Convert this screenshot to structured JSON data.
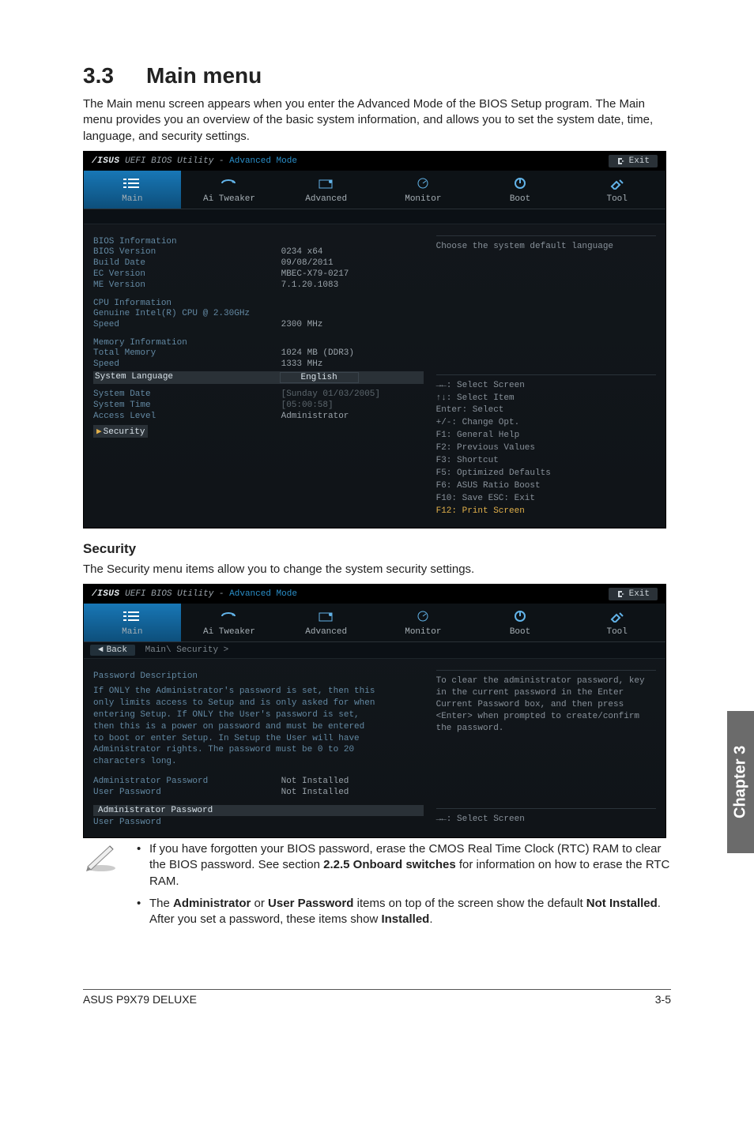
{
  "heading": {
    "num": "3.3",
    "title": "Main menu"
  },
  "intro": "The Main menu screen appears when you enter the Advanced Mode of the BIOS Setup program. The Main menu provides you an overview of the basic system information, and allows you to set the system date, time, language, and security settings.",
  "security_heading": "Security",
  "security_intro": "The Security menu items allow you to change the system security settings.",
  "bios_title": {
    "brand": "/ISUS",
    "mid": " UEFI BIOS Utility - ",
    "adv": "Advanced Mode",
    "exit": "Exit"
  },
  "tabs": [
    "Main",
    "Ai Tweaker",
    "Advanced",
    "Monitor",
    "Boot",
    "Tool"
  ],
  "main_panel": {
    "groups": [
      {
        "head": "BIOS Information",
        "rows": [
          {
            "k": "BIOS Version",
            "v": "0234 x64"
          },
          {
            "k": "Build Date",
            "v": "09/08/2011"
          },
          {
            "k": "EC Version",
            "v": "MBEC-X79-0217"
          },
          {
            "k": "ME Version",
            "v": "7.1.20.1083"
          }
        ]
      },
      {
        "head": "CPU Information",
        "rows": [
          {
            "k": "Genuine Intel(R) CPU @ 2.30GHz",
            "v": ""
          },
          {
            "k": "Speed",
            "v": "2300 MHz"
          }
        ]
      },
      {
        "head": "Memory Information",
        "rows": [
          {
            "k": "Total Memory",
            "v": "1024 MB (DDR3)"
          },
          {
            "k": "Speed",
            "v": "1333 MHz"
          }
        ]
      }
    ],
    "lang_label": "System Language",
    "lang_value": "English",
    "date_label": "System Date",
    "date_value": "[Sunday 01/03/2005]",
    "time_label": "System Time",
    "time_value": "[05:00:58]",
    "access_label": "Access Level",
    "access_value": "Administrator",
    "sec_link": "Security",
    "help": "Choose the system default language",
    "hotkeys": [
      "→←: Select Screen",
      "↑↓: Select Item",
      "Enter: Select",
      "+/-: Change Opt.",
      "F1: General Help",
      "F2: Previous Values",
      "F3: Shortcut",
      "F5: Optimized Defaults",
      "F6: ASUS Ratio Boost",
      "F10: Save  ESC: Exit",
      "F12: Print Screen"
    ]
  },
  "sec_panel": {
    "back": "Back",
    "crumb": "Main\\ Security >",
    "pd_head": "Password Description",
    "pd_body": "If ONLY the Administrator's password is set, then this only limits access to Setup and is only asked for when entering Setup. If ONLY the User's password is set, then this is a power on password and must be entered to boot or enter Setup. In Setup the User will have Administrator rights. The password must be 0 to 20 characters long.",
    "admin_status_k": "Administrator Password",
    "admin_status_v": "Not Installed",
    "user_status_k": "User Password",
    "user_status_v": "Not Installed",
    "admin_link": "Administrator Password",
    "user_link": "User Password",
    "help": "To clear the administrator password, key in the current password in the Enter Current Password box, and then press <Enter> when prompted to create/confirm the password.",
    "hotkey_first": "→←: Select Screen"
  },
  "notes": {
    "n1a": "If you have forgotten your BIOS password, erase the CMOS Real Time Clock (RTC) RAM to clear the BIOS password. See section ",
    "n1b": "2.2.5 Onboard switches",
    "n1c": " for information on how to erase the RTC RAM.",
    "n2a": "The ",
    "n2b": "Administrator",
    "n2c": " or ",
    "n2d": "User Password",
    "n2e": " items on top of the screen show the default ",
    "n2f": "Not Installed",
    "n2g": ". After you set a password, these items show ",
    "n2h": "Installed",
    "n2i": "."
  },
  "chapter_side": "Chapter 3",
  "footer": {
    "left": "ASUS P9X79 DELUXE",
    "right": "3-5"
  }
}
